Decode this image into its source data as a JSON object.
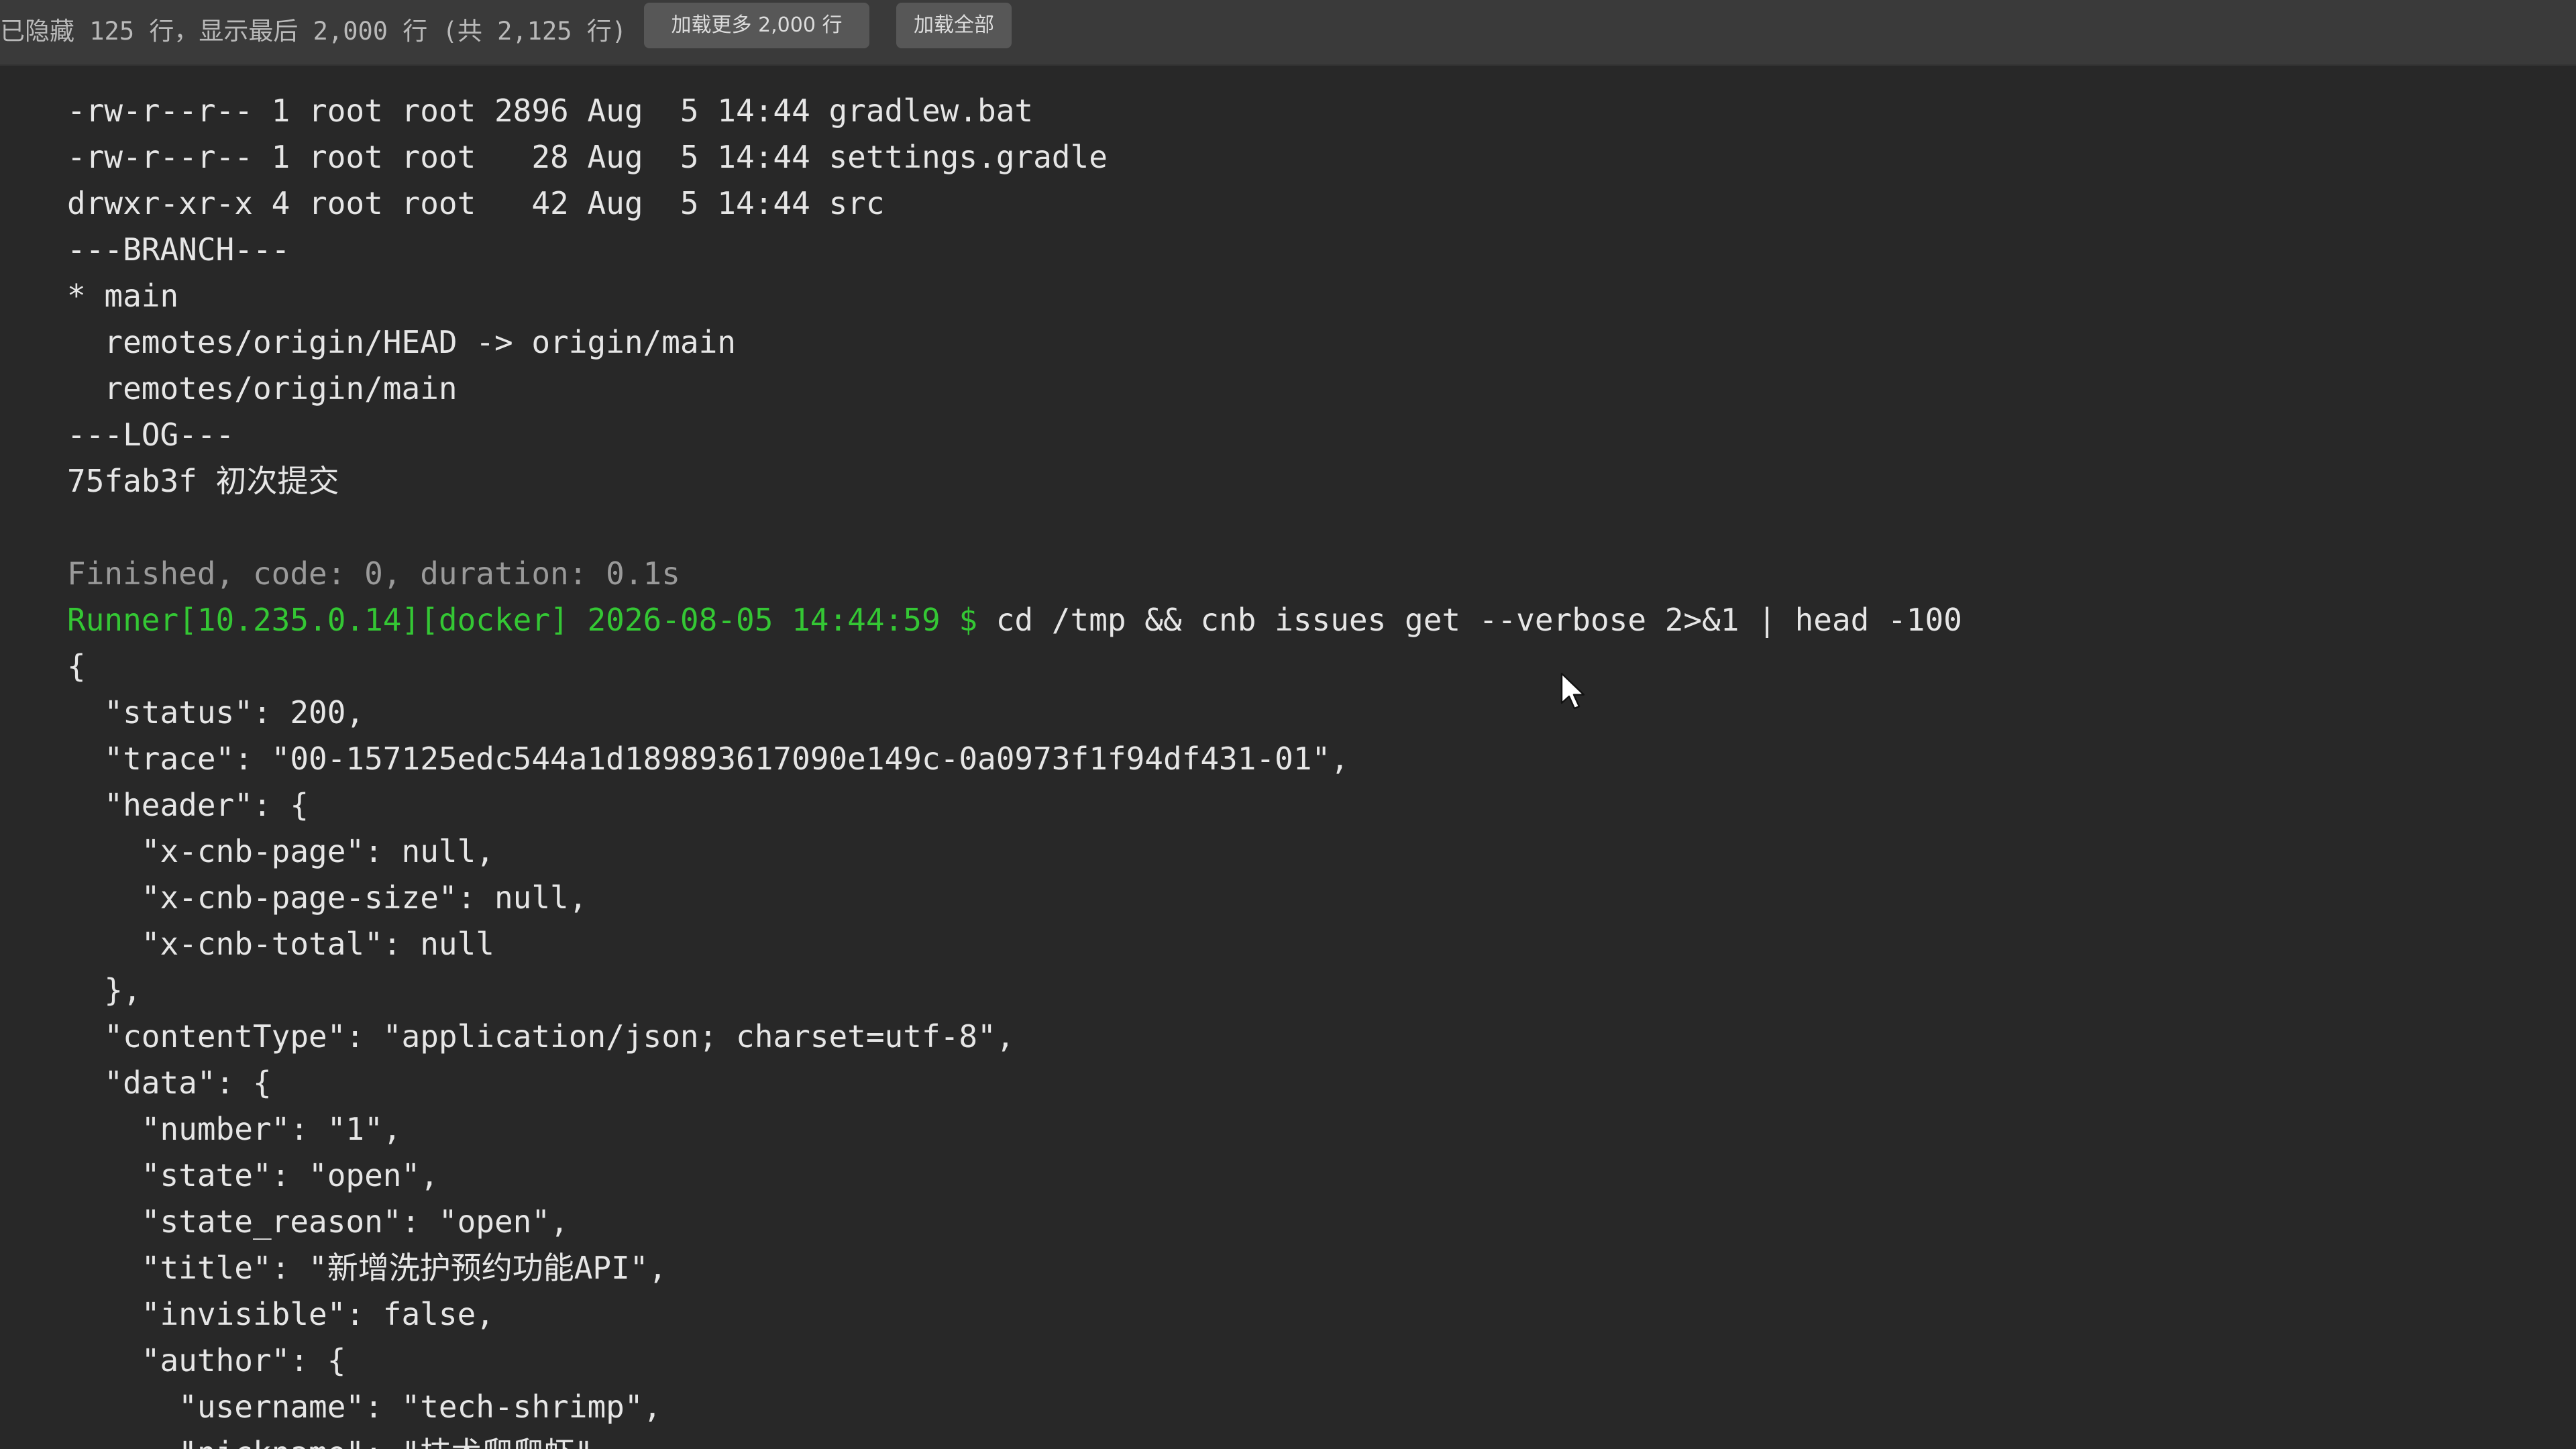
{
  "toolbar": {
    "info": "已隐藏 125 行，显示最后 2,000 行 (共 2,125 行)",
    "load_more_label": "加载更多 2,000 行",
    "load_all_label": "加载全部"
  },
  "terminal": {
    "prompt": "Runner[10.235.0.14][docker] 2026-08-05 14:44:59 $",
    "command": " cd /tmp && cnb issues get --verbose 2>&1 | head -100",
    "lines": [
      "-rw-r--r-- 1 root root 2896 Aug  5 14:44 gradlew.bat",
      "-rw-r--r-- 1 root root   28 Aug  5 14:44 settings.gradle",
      "drwxr-xr-x 4 root root   42 Aug  5 14:44 src",
      "---BRANCH---",
      "* main",
      "  remotes/origin/HEAD -> origin/main",
      "  remotes/origin/main",
      "---LOG---",
      "75fab3f 初次提交",
      "",
      "Finished, code: 0, duration: 0.1s",
      "",
      "{",
      "  \"status\": 200,",
      "  \"trace\": \"00-157125edc544a1d189893617090e149c-0a0973f1f94df431-01\",",
      "  \"header\": {",
      "    \"x-cnb-page\": null,",
      "    \"x-cnb-page-size\": null,",
      "    \"x-cnb-total\": null",
      "  },",
      "  \"contentType\": \"application/json; charset=utf-8\",",
      "  \"data\": {",
      "    \"number\": \"1\",",
      "    \"state\": \"open\",",
      "    \"state_reason\": \"open\",",
      "    \"title\": \"新增洗护预约功能API\",",
      "    \"invisible\": false,",
      "    \"author\": {",
      "      \"username\": \"tech-shrimp\",",
      "      \"nickname\": \"技术爬爬虾\","
    ]
  },
  "colors": {
    "background": "#282828",
    "toolbar": "#3a3a3a",
    "button": "#575757",
    "prompt_green": "#34c734",
    "muted_gray": "#9a9a9a",
    "text": "#e6e6e6"
  },
  "icons": {
    "cursor": "mouse-pointer-icon"
  }
}
